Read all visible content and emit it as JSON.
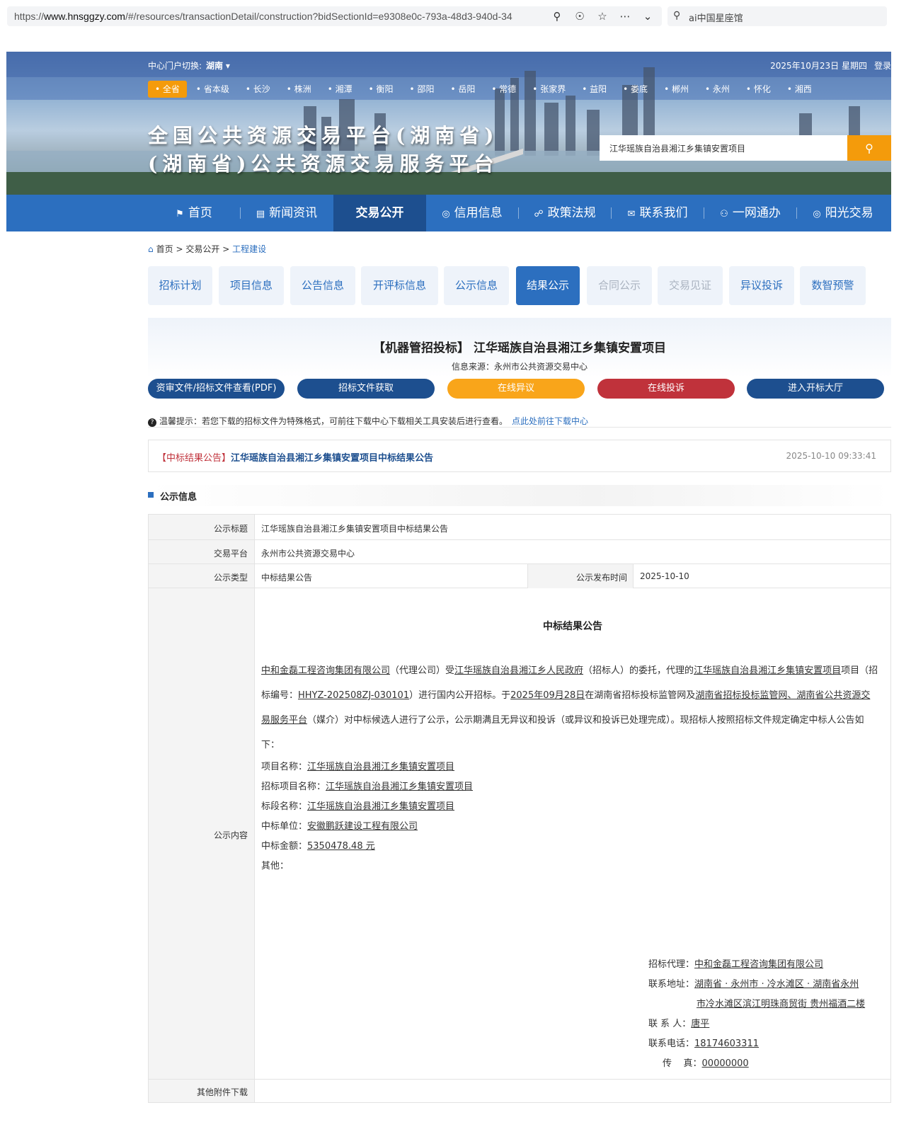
{
  "browser": {
    "url_prefix": "https://",
    "url_domain": "www.hnsggzy.com",
    "url_rest": "/#/resources/transactionDetail/construction?bidSectionId=e9308e0c-793a-48d3-940d-34",
    "search_text": "ai中国星座馆"
  },
  "header": {
    "portal_label": "中心门户切换:",
    "portal_value": "湖南",
    "date": "2025年10月23日 星期四",
    "login": "登录",
    "cities": [
      "全省",
      "省本级",
      "长沙",
      "株洲",
      "湘潭",
      "衡阳",
      "邵阳",
      "岳阳",
      "常德",
      "张家界",
      "益阳",
      "娄底",
      "郴州",
      "永州",
      "怀化",
      "湘西"
    ],
    "title_line1": "全国公共资源交易平台(湖南省)",
    "title_line2": "(湖南省)公共资源交易服务平台",
    "search_value": "江华瑶族自治县湘江乡集镇安置项目"
  },
  "nav": {
    "items": [
      "首页",
      "新闻资讯",
      "交易公开",
      "信用信息",
      "政策法规",
      "联系我们",
      "一网通办",
      "阳光交易"
    ]
  },
  "breadcrumb": {
    "home": "首页",
    "sep": ">",
    "level2": "交易公开",
    "current": "工程建设"
  },
  "tabs": [
    "招标计划",
    "项目信息",
    "公告信息",
    "开评标信息",
    "公示信息",
    "结果公示",
    "合同公示",
    "交易见证",
    "异议投诉",
    "数智预警"
  ],
  "project": {
    "title": "【机器管招投标】 江华瑶族自治县湘江乡集镇安置项目",
    "source": "信息来源：永州市公共资源交易中心",
    "buttons": [
      "资审文件/招标文件查看(PDF)",
      "招标文件获取",
      "在线异议",
      "在线投诉",
      "进入开标大厅"
    ],
    "tip": "温馨提示：若您下载的招标文件为特殊格式，可前往下载中心下载相关工具安装后进行查看。",
    "tip_link": "点此处前往下载中心"
  },
  "notice": {
    "tag": "【中标结果公告】",
    "title": "江华瑶族自治县湘江乡集镇安置项目中标结果公告",
    "time": "2025-10-10 09:33:41"
  },
  "section": {
    "title": "公示信息"
  },
  "info": {
    "rows": [
      {
        "label": "公示标题",
        "value": "江华瑶族自治县湘江乡集镇安置项目中标结果公告"
      },
      {
        "label": "交易平台",
        "value": "永州市公共资源交易中心"
      },
      {
        "label": "公示类型",
        "value": "中标结果公告"
      }
    ],
    "publish_label": "公示发布时间",
    "publish_value": "2025-10-10",
    "content_label": "公示内容",
    "attach_label": "其他附件下载"
  },
  "doc": {
    "heading": "中标结果公告",
    "p_agent": "中和金磊工程咨询集团有限公司",
    "p1": "（代理公司）受",
    "p_owner": "江华瑶族自治县湘江乡人民政府",
    "p2": "（招标人）的委托，代理的",
    "p_proj": "江华瑶族自治县湘江乡集镇安置项目",
    "p3": "项目（招标编号：",
    "p_code": "HHYZ-202508ZJ-030101",
    "p4": "）进行国内公开招标。于",
    "p_date": "2025年09月28日",
    "p5": "在湖南省招标投标监管网及",
    "p_media": "湖南省招标投标监管网、湖南省公共资源交易服务平台",
    "p6": "（媒介）对中标候选人进行了公示，公示期满且无异议和投诉（或异议和投诉已处理完成）。现招标人按照招标文件规定确定中标人公告如下：",
    "items": [
      {
        "k": "项目名称：",
        "v": "江华瑶族自治县湘江乡集镇安置项目"
      },
      {
        "k": "招标项目名称：",
        "v": "江华瑶族自治县湘江乡集镇安置项目"
      },
      {
        "k": "标段名称：",
        "v": "江华瑶族自治县湘江乡集镇安置项目"
      },
      {
        "k": "中标单位：",
        "v": "安徽鹏跃建设工程有限公司"
      },
      {
        "k": "中标金额：",
        "v": "5350478.48 元"
      },
      {
        "k": "其他：",
        "v": ""
      }
    ],
    "sign": {
      "agent_k": "招标代理：",
      "agent_v": "中和金磊工程咨询集团有限公司",
      "addr_k": "联系地址：",
      "addr_v1": "湖南省 · 永州市 · 冷水滩区 · 湖南省永州",
      "addr_v2": "市冷水滩区滨江明珠商贸街 贵州福酒二楼",
      "contact_k": "联 系 人：",
      "contact_v": "唐平",
      "phone_k": "联系电话：",
      "phone_v": "18174603311",
      "fax_k": "传    真：",
      "fax_v": "00000000"
    }
  }
}
